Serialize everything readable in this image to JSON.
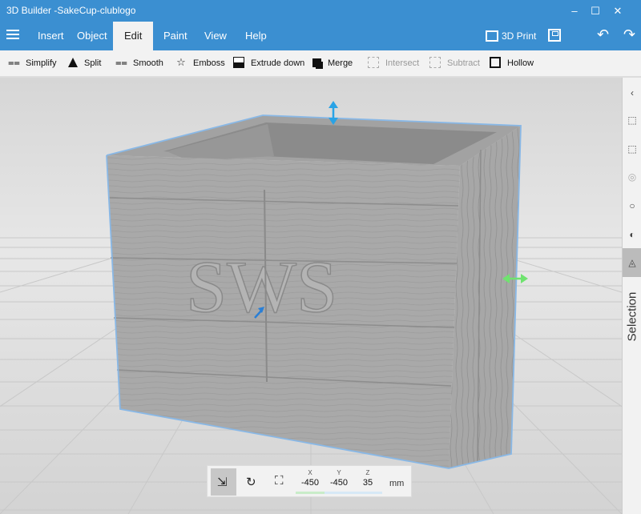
{
  "window": {
    "title": "3D Builder -SakeCup-clublogo"
  },
  "menu": {
    "items": [
      "Insert",
      "Object",
      "Edit",
      "Paint",
      "View",
      "Help"
    ],
    "active": "Edit",
    "print_label": "3D Print"
  },
  "toolbar": {
    "simplify": "Simplify",
    "split": "Split",
    "smooth": "Smooth",
    "emboss": "Emboss",
    "extrude_down": "Extrude down",
    "merge": "Merge",
    "intersect": "Intersect",
    "subtract": "Subtract",
    "hollow": "Hollow"
  },
  "model": {
    "logo_text": "SWS"
  },
  "right_panel": {
    "label": "Selection"
  },
  "transform": {
    "x_label": "X",
    "y_label": "Y",
    "z_label": "Z",
    "x": "-450",
    "y": "-450",
    "z": "35",
    "unit": "mm"
  },
  "colors": {
    "accent": "#3b8fd1",
    "handle_z": "#29a3e6",
    "handle_y": "#6fe36f",
    "handle_x": "#2a7fd6",
    "selection_outline": "#89b8e6"
  }
}
